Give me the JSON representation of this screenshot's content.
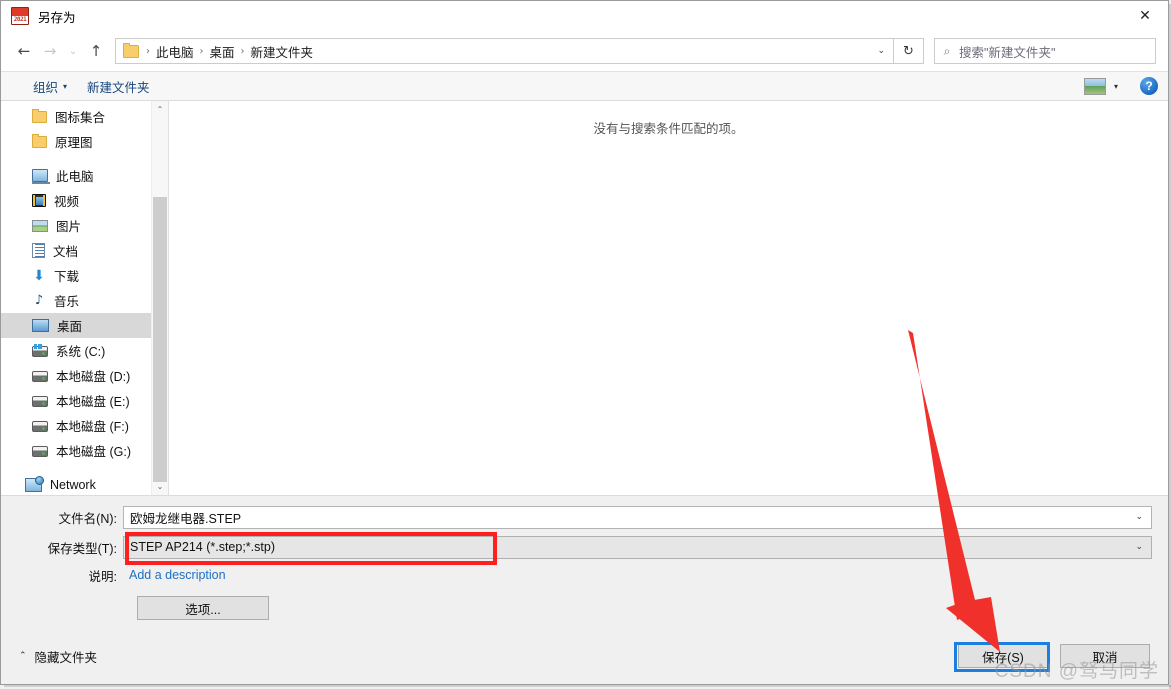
{
  "window": {
    "title": "另存为",
    "app_icon_year": "2021",
    "close_label": "✕"
  },
  "nav": {
    "back_icon": "←",
    "forward_icon": "→",
    "recent_icon": "⌄",
    "up_icon": "↑",
    "refresh_icon": "↻",
    "breadcrumbs": [
      "此电脑",
      "桌面",
      "新建文件夹"
    ],
    "separator": "›",
    "address_chevron": "⌄"
  },
  "search": {
    "icon": "⌕",
    "placeholder": "搜索\"新建文件夹\""
  },
  "toolbar": {
    "organize_label": "组织",
    "organize_caret": "▾",
    "new_folder_label": "新建文件夹",
    "view_caret": "▾",
    "help_label": "?"
  },
  "sidebar": {
    "groups": [
      {
        "items": [
          {
            "label": "图标集合",
            "icon": "folder-icon",
            "selected": false
          },
          {
            "label": "原理图",
            "icon": "folder-icon",
            "selected": false
          }
        ]
      },
      {
        "items": [
          {
            "label": "此电脑",
            "icon": "this-pc-icon",
            "selected": false
          },
          {
            "label": "视频",
            "icon": "videos-icon",
            "selected": false
          },
          {
            "label": "图片",
            "icon": "pictures-icon",
            "selected": false
          },
          {
            "label": "文档",
            "icon": "documents-icon",
            "selected": false
          },
          {
            "label": "下载",
            "icon": "downloads-icon",
            "selected": false
          },
          {
            "label": "音乐",
            "icon": "music-icon",
            "selected": false
          },
          {
            "label": "桌面",
            "icon": "desktop-icon",
            "selected": true
          },
          {
            "label": "系统 (C:)",
            "icon": "system-drive-icon",
            "selected": false
          },
          {
            "label": "本地磁盘 (D:)",
            "icon": "drive-icon",
            "selected": false
          },
          {
            "label": "本地磁盘 (E:)",
            "icon": "drive-icon",
            "selected": false
          },
          {
            "label": "本地磁盘 (F:)",
            "icon": "drive-icon",
            "selected": false
          },
          {
            "label": "本地磁盘 (G:)",
            "icon": "drive-icon",
            "selected": false
          }
        ]
      },
      {
        "items": [
          {
            "label": "Network",
            "icon": "network-icon",
            "selected": false
          }
        ]
      }
    ],
    "scroll_up_icon": "⌃",
    "scroll_down_icon": "⌄"
  },
  "filelist": {
    "empty_message": "没有与搜索条件匹配的项。"
  },
  "form": {
    "filename_label": "文件名(N):",
    "filename_value": "欧姆龙继电器.STEP",
    "filetype_label": "保存类型(T):",
    "filetype_value": "STEP AP214 (*.step;*.stp)",
    "description_label": "说明:",
    "description_link": "Add a description",
    "options_button": "选项...",
    "chevron": "⌄"
  },
  "footer": {
    "hide_folders_caret": "⌃",
    "hide_folders_label": "隐藏文件夹",
    "save_button": "保存(S)",
    "cancel_button": "取消"
  },
  "annotations": {
    "filetype_box_color": "#ff1f1f",
    "save_box_color": "#1b7fe0",
    "arrow_color": "#f0302a",
    "watermark": "CSDN @驽马同学"
  }
}
